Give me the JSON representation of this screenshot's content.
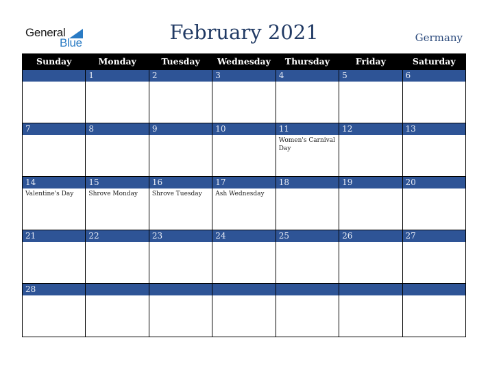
{
  "logo": {
    "line1": "General",
    "line2": "Blue"
  },
  "header": {
    "title": "February 2021",
    "country": "Germany"
  },
  "colors": {
    "accent": "#2e5496",
    "title": "#213a64",
    "header_bg": "#000000",
    "logo_blue": "#2a7bc4"
  },
  "weekdays": [
    "Sunday",
    "Monday",
    "Tuesday",
    "Wednesday",
    "Thursday",
    "Friday",
    "Saturday"
  ],
  "weeks": [
    {
      "days": [
        {
          "num": "",
          "event": ""
        },
        {
          "num": "1",
          "event": ""
        },
        {
          "num": "2",
          "event": ""
        },
        {
          "num": "3",
          "event": ""
        },
        {
          "num": "4",
          "event": ""
        },
        {
          "num": "5",
          "event": ""
        },
        {
          "num": "6",
          "event": ""
        }
      ]
    },
    {
      "days": [
        {
          "num": "7",
          "event": ""
        },
        {
          "num": "8",
          "event": ""
        },
        {
          "num": "9",
          "event": ""
        },
        {
          "num": "10",
          "event": ""
        },
        {
          "num": "11",
          "event": "Women's Carnival Day"
        },
        {
          "num": "12",
          "event": ""
        },
        {
          "num": "13",
          "event": ""
        }
      ]
    },
    {
      "days": [
        {
          "num": "14",
          "event": "Valentine's Day"
        },
        {
          "num": "15",
          "event": "Shrove Monday"
        },
        {
          "num": "16",
          "event": "Shrove Tuesday"
        },
        {
          "num": "17",
          "event": "Ash Wednesday"
        },
        {
          "num": "18",
          "event": ""
        },
        {
          "num": "19",
          "event": ""
        },
        {
          "num": "20",
          "event": ""
        }
      ]
    },
    {
      "days": [
        {
          "num": "21",
          "event": ""
        },
        {
          "num": "22",
          "event": ""
        },
        {
          "num": "23",
          "event": ""
        },
        {
          "num": "24",
          "event": ""
        },
        {
          "num": "25",
          "event": ""
        },
        {
          "num": "26",
          "event": ""
        },
        {
          "num": "27",
          "event": ""
        }
      ]
    },
    {
      "days": [
        {
          "num": "28",
          "event": ""
        },
        {
          "num": "",
          "event": ""
        },
        {
          "num": "",
          "event": ""
        },
        {
          "num": "",
          "event": ""
        },
        {
          "num": "",
          "event": ""
        },
        {
          "num": "",
          "event": ""
        },
        {
          "num": "",
          "event": ""
        }
      ]
    }
  ]
}
